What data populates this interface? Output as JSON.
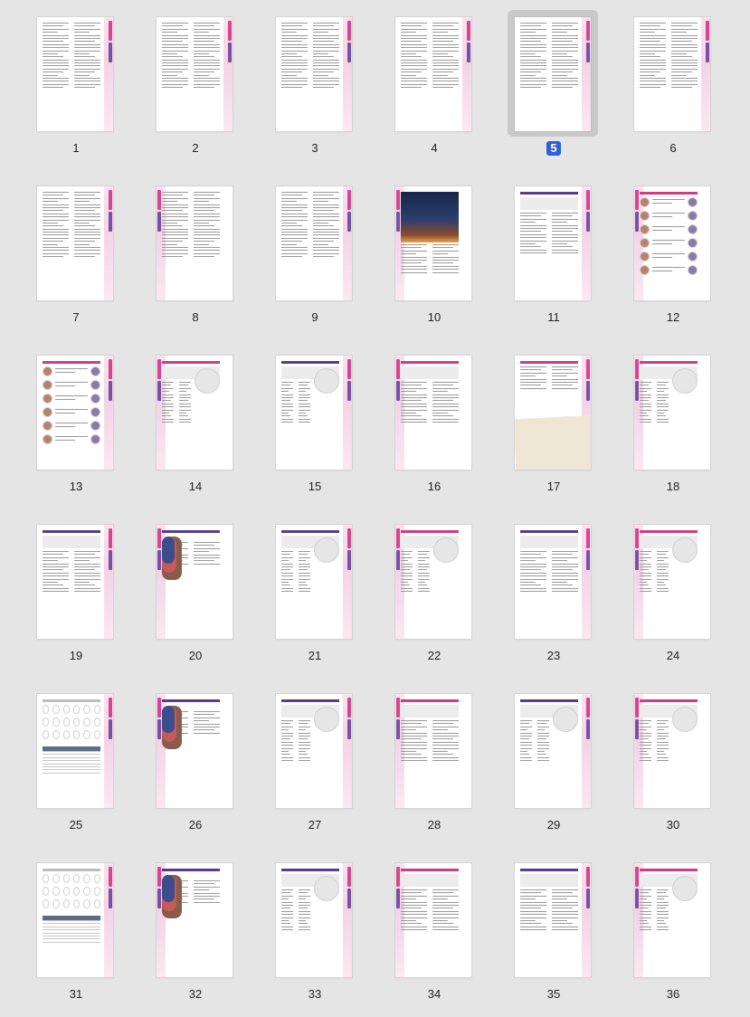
{
  "selected_page": 5,
  "pages": [
    {
      "label": "1"
    },
    {
      "label": "2"
    },
    {
      "label": "3"
    },
    {
      "label": "4"
    },
    {
      "label": "5"
    },
    {
      "label": "6"
    },
    {
      "label": "7"
    },
    {
      "label": "8"
    },
    {
      "label": "9"
    },
    {
      "label": "10"
    },
    {
      "label": "11"
    },
    {
      "label": "12"
    },
    {
      "label": "13"
    },
    {
      "label": "14"
    },
    {
      "label": "15"
    },
    {
      "label": "16"
    },
    {
      "label": "17"
    },
    {
      "label": "18"
    },
    {
      "label": "19"
    },
    {
      "label": "20"
    },
    {
      "label": "21"
    },
    {
      "label": "22"
    },
    {
      "label": "23"
    },
    {
      "label": "24"
    },
    {
      "label": "25"
    },
    {
      "label": "26"
    },
    {
      "label": "27"
    },
    {
      "label": "28"
    },
    {
      "label": "29"
    },
    {
      "label": "30"
    },
    {
      "label": "31"
    },
    {
      "label": "32"
    },
    {
      "label": "33"
    },
    {
      "label": "34"
    },
    {
      "label": "35"
    },
    {
      "label": "36"
    }
  ],
  "colors": {
    "selected_badge": "#2f5fd7",
    "accent_pink": "#cf3c86",
    "accent_purple": "#5a3b8c",
    "background": "#e5e5e5"
  }
}
